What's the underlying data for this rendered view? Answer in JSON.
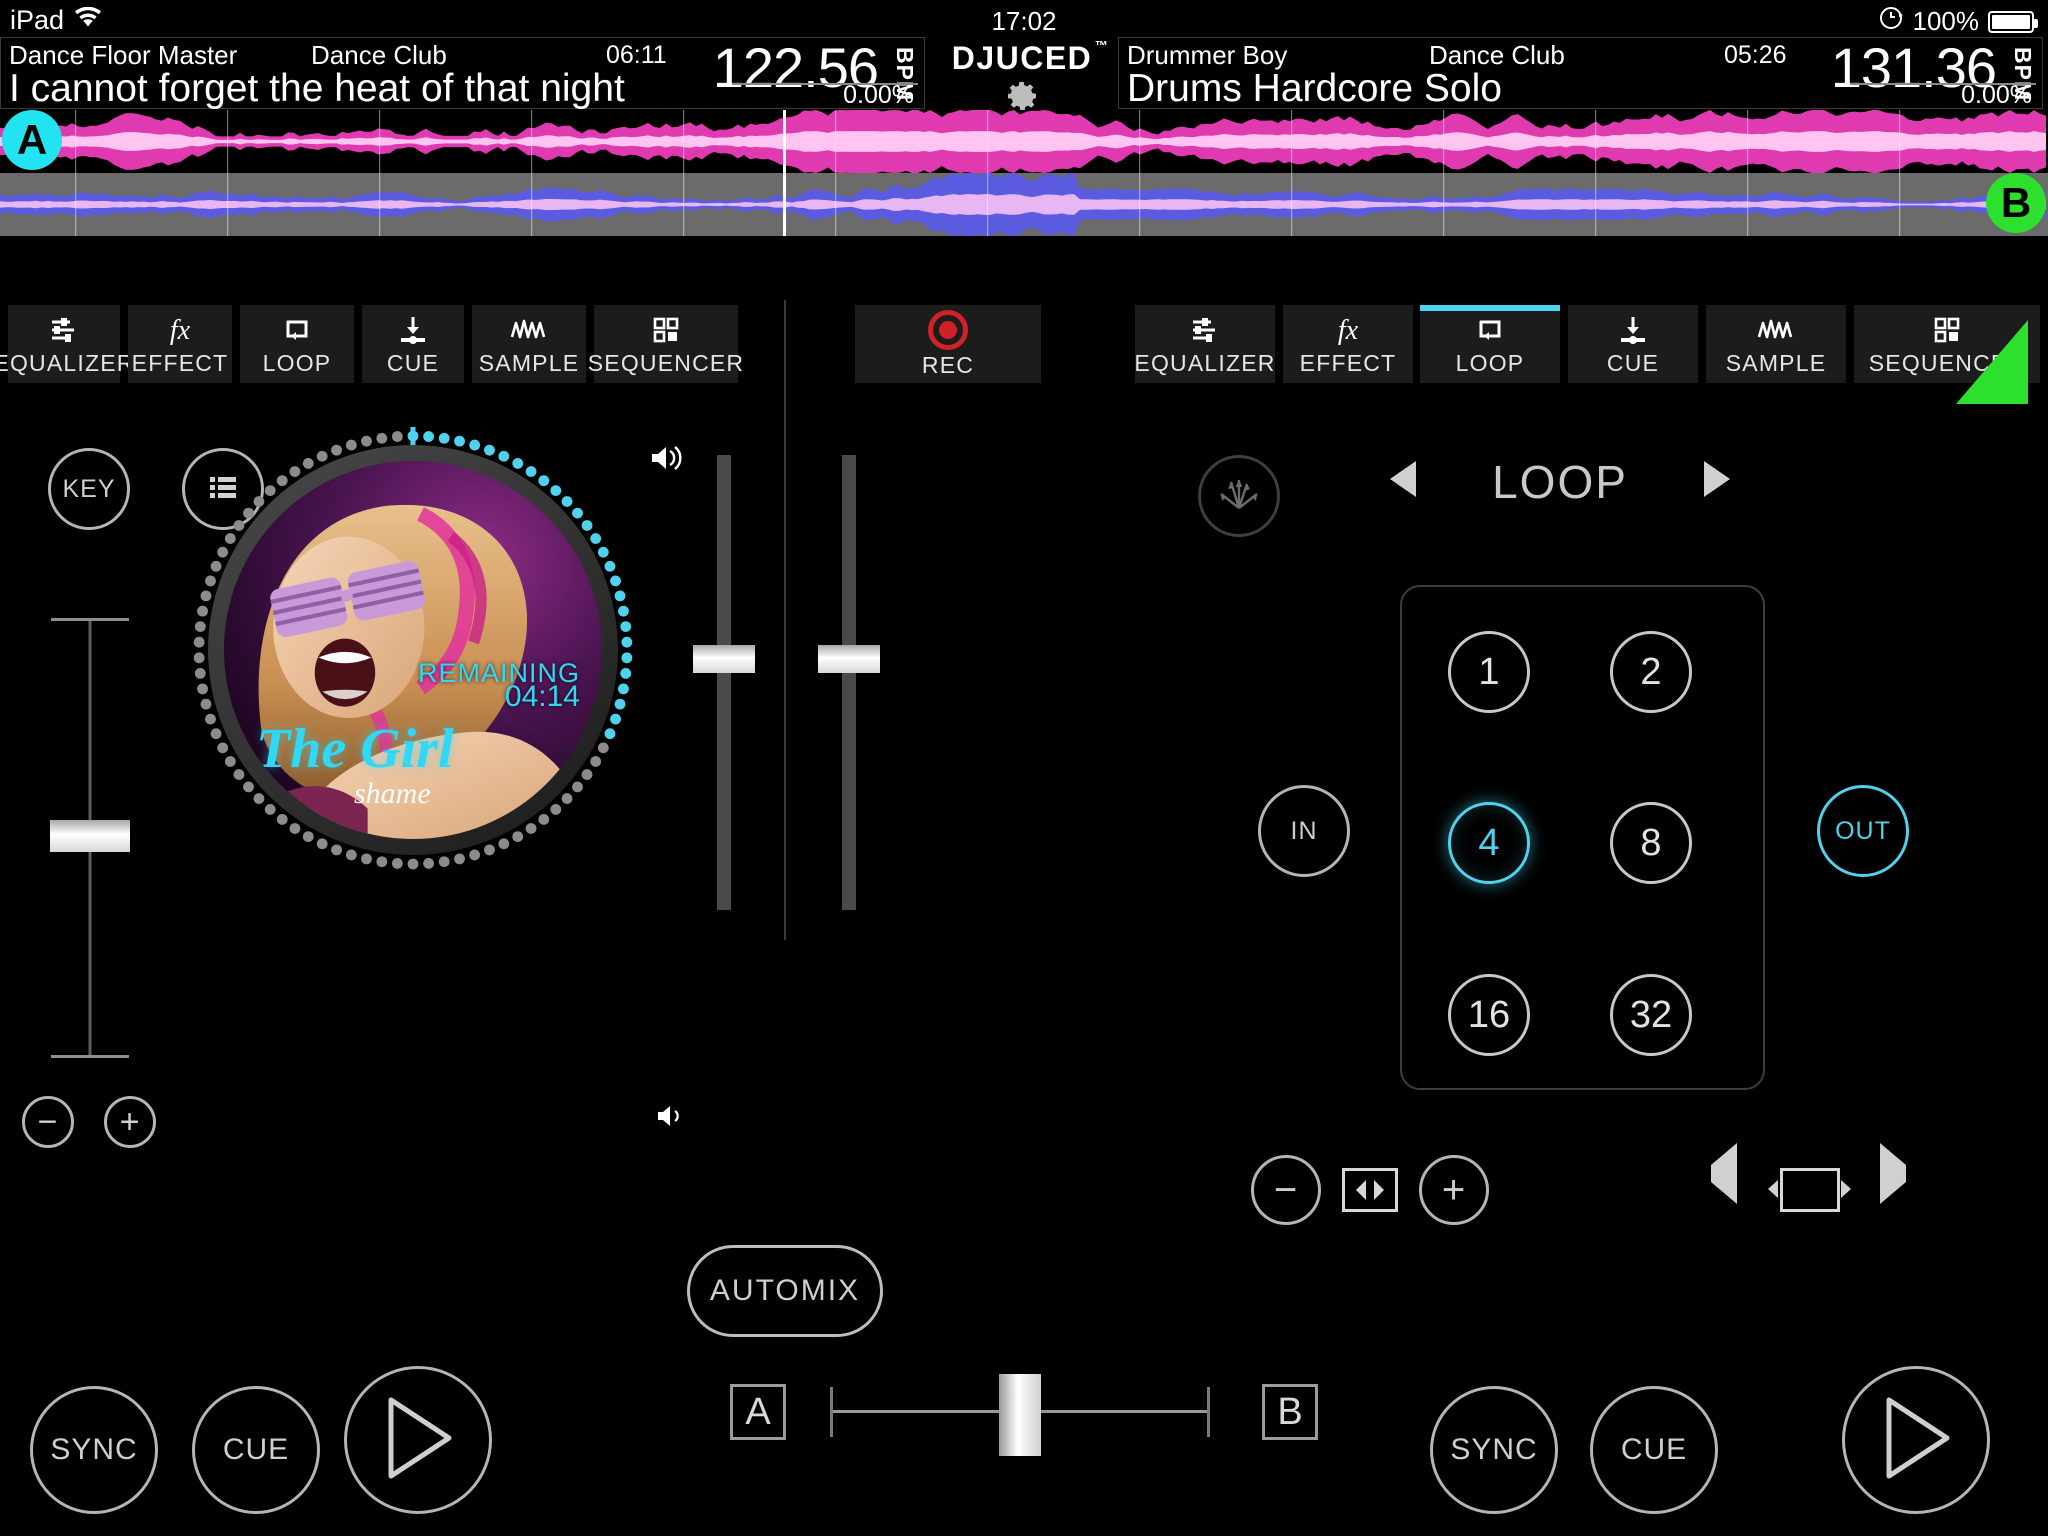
{
  "status_bar": {
    "device": "iPad",
    "wifi_icon": "wifi-icon",
    "time": "17:02",
    "lock_icon": "rotation-lock-icon",
    "battery_percent": "100%",
    "battery_icon": "battery-icon"
  },
  "brand": {
    "name": "DJUCED",
    "tm": "™",
    "settings_icon": "gear-icon"
  },
  "decks": {
    "a": {
      "badge": "A",
      "badge_color": "#22e3f0",
      "artist": "Dance Floor Master",
      "album": "Dance Club",
      "duration": "06:11",
      "title": "I cannot forget the heat of that night",
      "bpm": "122.56",
      "bpm_label": "BPM",
      "pitch": "0.00%",
      "remaining_label": "REMAINING",
      "remaining_time": "04:14",
      "art_title": "The Girl",
      "art_subtitle": "shame"
    },
    "b": {
      "badge": "B",
      "badge_color": "#2de02d",
      "artist": "Drummer Boy",
      "album": "Dance Club",
      "duration": "05:26",
      "title": "Drums Hardcore Solo",
      "bpm": "131.36",
      "bpm_label": "BPM",
      "pitch": "0.00%"
    }
  },
  "toolbar": {
    "left_tabs": [
      {
        "label": "EQUALIZER",
        "icon": "equalizer-icon",
        "active": false
      },
      {
        "label": "EFFECT",
        "icon": "fx-icon",
        "active": false
      },
      {
        "label": "LOOP",
        "icon": "loop-icon",
        "active": false
      },
      {
        "label": "CUE",
        "icon": "cue-icon",
        "active": false
      },
      {
        "label": "SAMPLE",
        "icon": "sample-icon",
        "active": false
      },
      {
        "label": "SEQUENCER",
        "icon": "sequencer-icon",
        "active": false
      }
    ],
    "rec": {
      "label": "REC",
      "icon": "record-icon",
      "color": "#cf2127"
    },
    "right_tabs": [
      {
        "label": "EQUALIZER",
        "icon": "equalizer-icon",
        "active": false
      },
      {
        "label": "EFFECT",
        "icon": "fx-icon",
        "active": false
      },
      {
        "label": "LOOP",
        "icon": "loop-icon",
        "active": true
      },
      {
        "label": "CUE",
        "icon": "cue-icon",
        "active": false
      },
      {
        "label": "SAMPLE",
        "icon": "sample-icon",
        "active": false
      },
      {
        "label": "SEQUENCER",
        "icon": "sequencer-icon",
        "active": false
      }
    ]
  },
  "left_deck_controls": {
    "key_button": "KEY",
    "browser_icon": "list-icon",
    "minus": "−",
    "plus": "+",
    "headphone_icon": "headphone-cue-icon",
    "speaker_icon": "speaker-icon"
  },
  "loop_panel": {
    "title": "LOOP",
    "prev_icon": "arrow-left-icon",
    "next_icon": "arrow-right-icon",
    "slip_icon": "slip-mode-icon",
    "in_button": "IN",
    "out_button": "OUT",
    "pads": [
      "1",
      "2",
      "4",
      "8",
      "16",
      "32"
    ],
    "active_pad": "4",
    "active_color": "#4fd2ee",
    "size_minus": "−",
    "size_plus": "+",
    "size_icon": "loop-size-icon",
    "move_left_icon": "move-left-icon",
    "move_box_icon": "loop-move-icon",
    "move_right_icon": "move-right-icon"
  },
  "transport": {
    "left": {
      "sync": "SYNC",
      "cue": "CUE",
      "play_icon": "play-icon"
    },
    "right": {
      "sync": "SYNC",
      "cue": "CUE",
      "play_icon": "play-icon"
    }
  },
  "mixer": {
    "automix": "AUTOMIX",
    "crossfader_a": "A",
    "crossfader_b": "B",
    "crossfader_position_pct": 50
  },
  "colors": {
    "accent_cyan": "#4fd2ee",
    "deck_a_wave": "#e03ab0",
    "deck_b_wave": "#5b5be0",
    "green": "#2de02d",
    "rec_red": "#cf2127",
    "panel_bg": "#1c1c1c"
  }
}
